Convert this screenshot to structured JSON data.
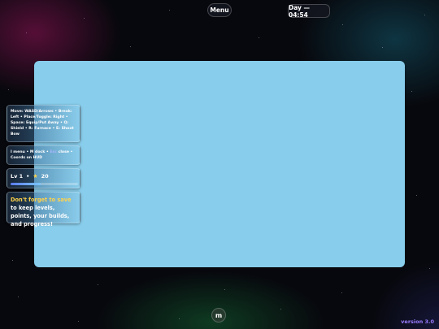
{
  "header": {
    "menu_label": "Menu",
    "time_badge": "Day — 04:54"
  },
  "hud": {
    "controls_text": "Move: WASD/Arrows • Break: Left • Place/Toggle: Right • Space: Equip/Put Away • Q: Shield • R: Furnace • E: Shoot Bow",
    "keys": {
      "part1": "I menu • M dock • ",
      "muted": "Esc",
      "part2": " close • Coords on HUD"
    },
    "level": {
      "label": "Lv 1",
      "separator": "•",
      "star_icon": "star-icon",
      "points": "20",
      "progress": 0.45
    },
    "save_reminder": {
      "highlight": "Don't forget to save",
      "rest": " to keep levels, points, your builds, and progress!"
    }
  },
  "footer": {
    "m_button": "m",
    "version": "version 3.0"
  },
  "colors": {
    "viewport_sky": "#88cdeb",
    "highlight_yellow": "#ffd24a",
    "version_purple": "#9a7bff"
  }
}
